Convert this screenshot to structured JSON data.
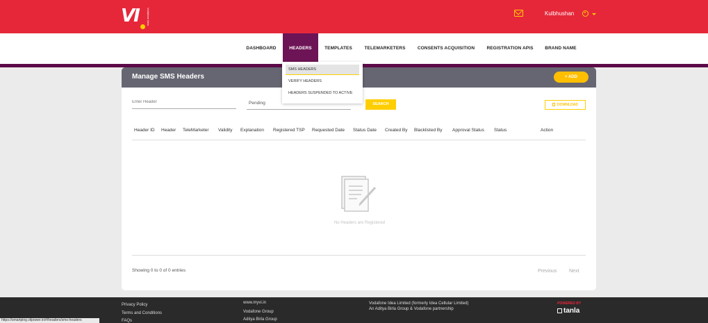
{
  "header": {
    "logo_text": "VI",
    "logo_subtext": "Vodafone Idea",
    "username": "Kulbhushan"
  },
  "nav": {
    "items": [
      {
        "label": "DASHBOARD"
      },
      {
        "label": "HEADERS"
      },
      {
        "label": "TEMPLATES"
      },
      {
        "label": "TELEMARKETERS"
      },
      {
        "label": "CONSENTS ACQUISITION"
      },
      {
        "label": "REGISTRATION APIS"
      },
      {
        "label": "BRAND NAME"
      }
    ],
    "active": "HEADERS"
  },
  "dropdown": {
    "items": [
      {
        "label": "SMS HEADERS"
      },
      {
        "label": "VERIFY HEADERS"
      },
      {
        "label": "HEADERS SUSPENDED TO ACTIVE"
      }
    ]
  },
  "card": {
    "title": "Manage SMS Headers",
    "add_label": "+ ADD",
    "header_placeholder": "Enter Header",
    "status_value": "Pending",
    "search_label": "SEARCH",
    "download_label": "DOWNLOAD",
    "columns": [
      "Header ID",
      "Header",
      "TeleMarketer",
      "Validity",
      "Explanation",
      "Registered TSP",
      "Requested Date",
      "Status Date",
      "Created By",
      "Blacklisted By",
      "Approval Status",
      "Status",
      "Action"
    ],
    "empty_text": "No Headers are Registered",
    "showing_text": "Showing 0 to 0 of 0 entries",
    "prev_label": "Previous",
    "next_label": "Next"
  },
  "footer": {
    "links_col1": [
      "Privacy Policy",
      "Terms and Conditions",
      "FAQs"
    ],
    "links_col2": [
      "www.myvi.in",
      "Vodafone Group",
      "Aditya Birla Group"
    ],
    "company_text": "Vodafone Idea Limited (formerly Idea Cellular Limited) An Aditya Birla Group & Vodafone partnership",
    "powered_by": "POWERED BY",
    "powered_brand": "tanla"
  },
  "statusbar": {
    "url": "https://smartping.vilpower.in/#/headers/sms-headers"
  },
  "colors": {
    "brand_red": "#e6273a",
    "nav_active": "#6d1456",
    "accent_yellow": "#ffce00",
    "card_header": "#666672"
  }
}
